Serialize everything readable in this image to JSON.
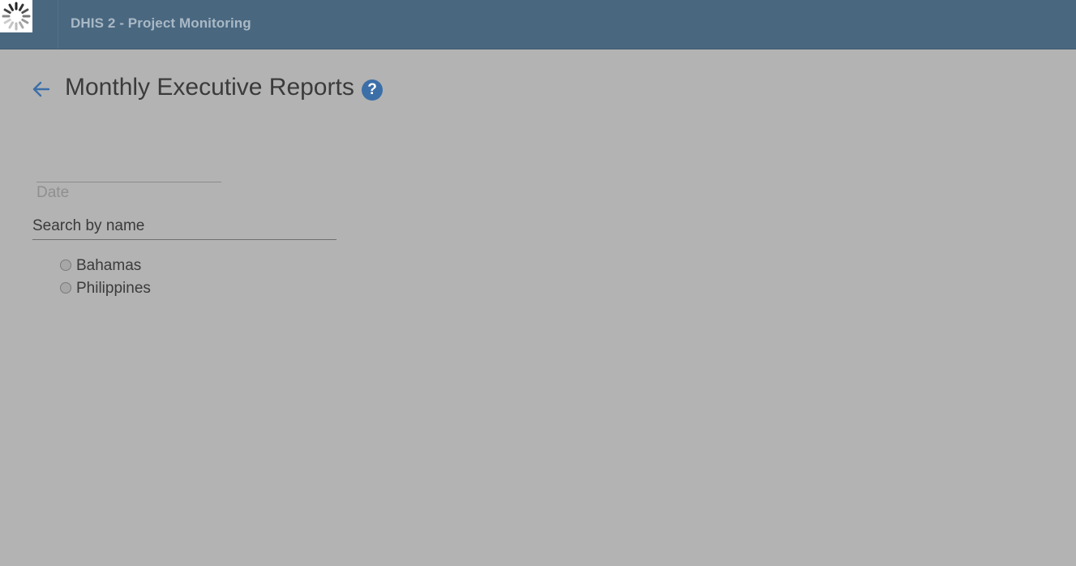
{
  "header": {
    "title": "DHIS 2 - Project Monitoring",
    "logo_icon": "loading-spinner-icon",
    "background": "#4a6780"
  },
  "page": {
    "title": "Monthly Executive Reports",
    "back_icon": "arrow-left-icon",
    "help_icon": "question-mark-icon",
    "help_glyph": "?",
    "accent_color": "#3c6fa8",
    "overlay_color": "#b3b3b3"
  },
  "filters": {
    "date_label": "Date",
    "search_placeholder": "Search by name",
    "search_value": ""
  },
  "org_units": [
    {
      "label": "Bahamas",
      "selected": false
    },
    {
      "label": "Philippines",
      "selected": false
    }
  ]
}
